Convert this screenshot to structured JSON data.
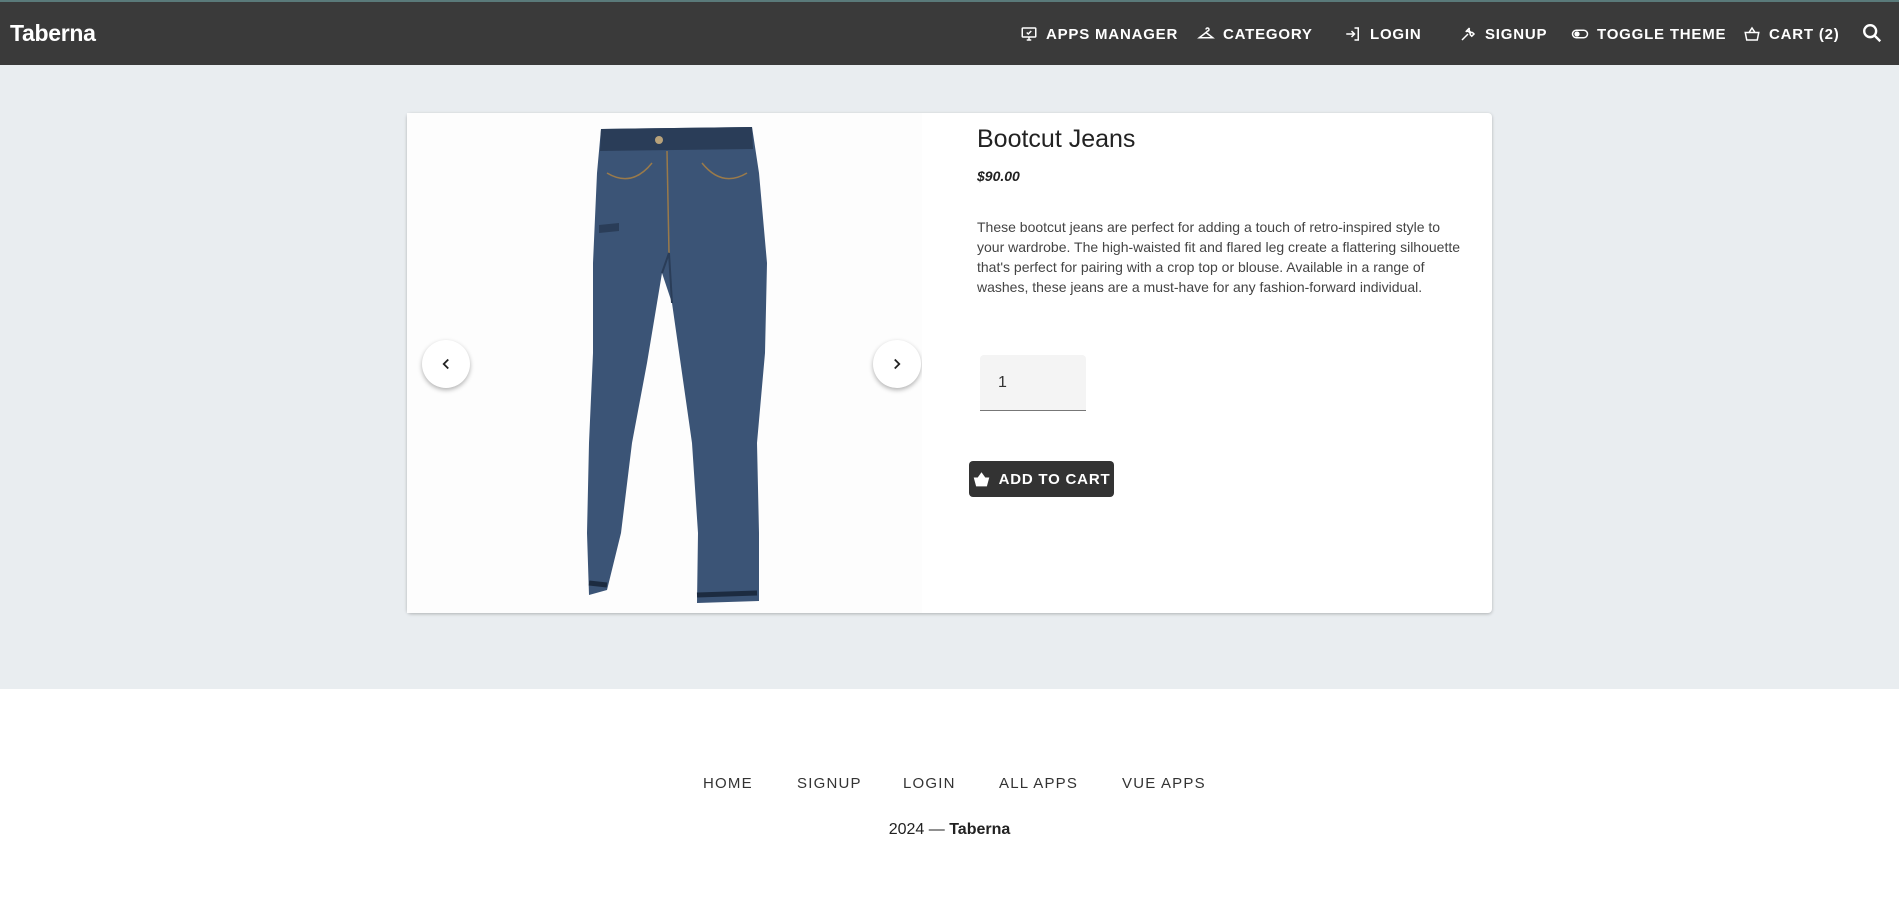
{
  "header": {
    "brand": "Taberna",
    "nav": [
      {
        "label": "APPS MANAGER",
        "icon": "monitor-icon"
      },
      {
        "label": "CATEGORY",
        "icon": "hanger-icon"
      },
      {
        "label": "LOGIN",
        "icon": "login-icon"
      },
      {
        "label": "SIGNUP",
        "icon": "tools-icon"
      },
      {
        "label": "TOGGLE THEME",
        "icon": "toggle-icon"
      },
      {
        "label": "CART (2)",
        "icon": "basket-icon"
      }
    ],
    "search_icon": "search-icon"
  },
  "product": {
    "title": "Bootcut Jeans",
    "price": "$90.00",
    "description": "These bootcut jeans are perfect for adding a touch of retro-inspired style to your wardrobe. The high-waisted fit and flared leg create a flattering silhouette that's perfect for pairing with a crop top or blouse. Available in a range of washes, these jeans are a must-have for any fashion-forward individual.",
    "quantity": "1",
    "add_to_cart_label": "ADD TO CART",
    "image_colors": {
      "denim": "#3b5476",
      "denim_dark": "#2a3d58",
      "stitch": "#9a7a4a"
    }
  },
  "footer": {
    "links": [
      "HOME",
      "SIGNUP",
      "LOGIN",
      "ALL APPS",
      "VUE APPS"
    ],
    "copyright_year": "2024 —",
    "copyright_brand": "Taberna"
  },
  "colors": {
    "topbar": "#3a3a3a",
    "page_bg": "#e9edf0",
    "button": "#333333"
  }
}
